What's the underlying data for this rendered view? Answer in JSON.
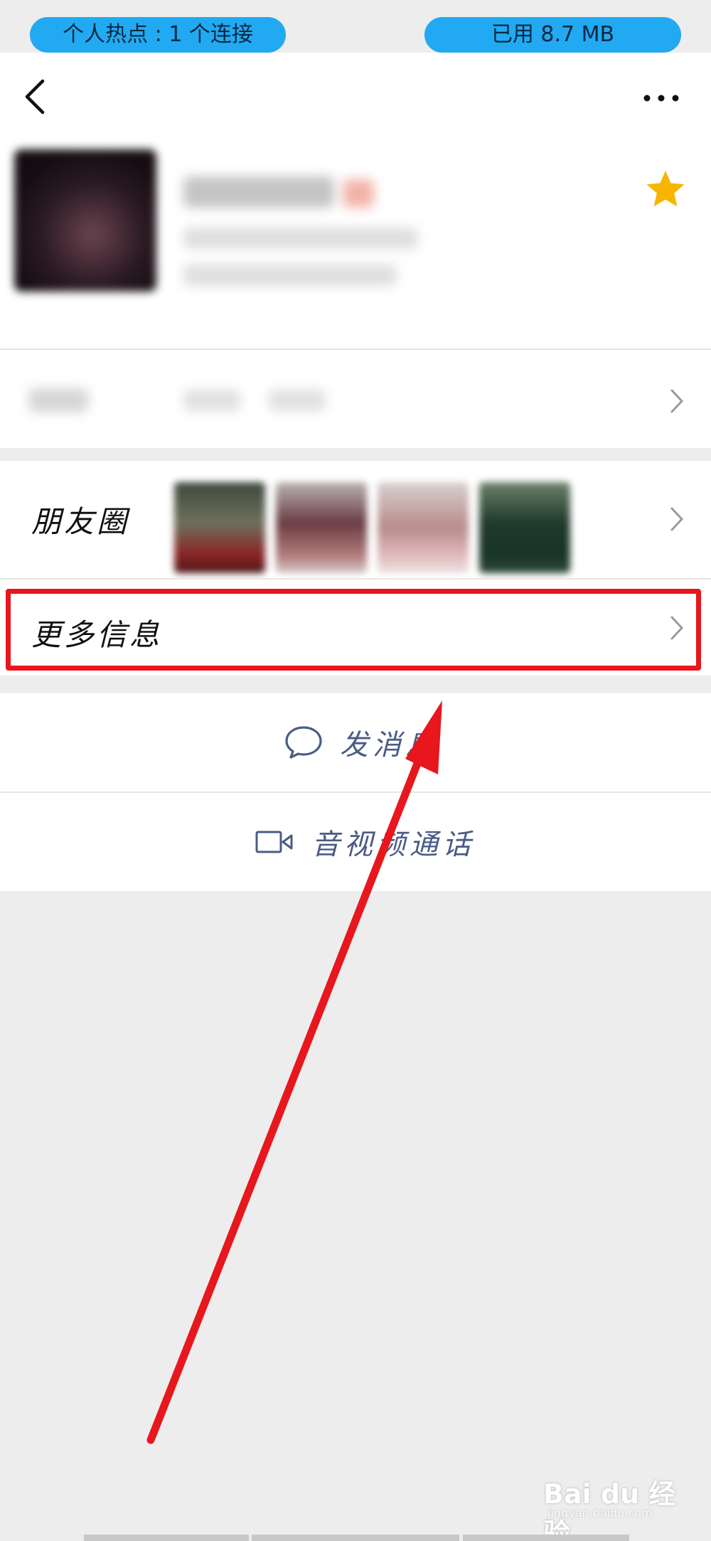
{
  "status": {
    "hotspot_label": "个人热点 : 1 个连接",
    "data_usage_label": "已用 8.7 MB",
    "pill_color": "#21aaf2"
  },
  "header": {
    "back_icon": "chevron-left-icon",
    "more_icon": "more-horizontal-icon"
  },
  "profile": {
    "favorite_icon": "star-icon",
    "star_color": "#f7b500"
  },
  "rows": {
    "moments_label": "朋友圈",
    "more_info_label": "更多信息"
  },
  "actions": {
    "message_label": "发消息",
    "message_icon": "chat-bubble-icon",
    "call_label": "音视频通话",
    "call_icon": "video-camera-icon",
    "label_color": "#4a5c85"
  },
  "annotation": {
    "highlight_color": "#e8161d",
    "arrow_color": "#e8161d"
  },
  "watermark": {
    "main": "Bai du 经验",
    "sub": "jingyan.baidu.com"
  }
}
